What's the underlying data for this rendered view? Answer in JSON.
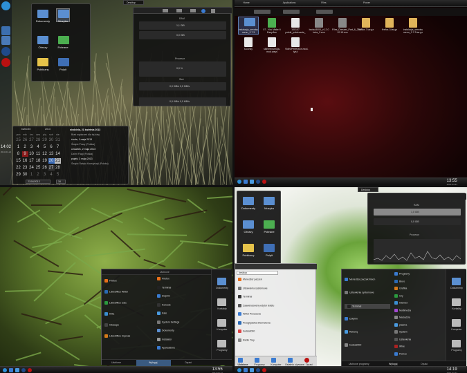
{
  "q1": {
    "desktop_tab": "Desktop",
    "folders": [
      {
        "label": "Dokumenty",
        "color": "#5b8fd1"
      },
      {
        "label": "Muzyka",
        "color": "#5b8fd1"
      },
      {
        "label": "Obrazy",
        "color": "#5b8fd1"
      },
      {
        "label": "Pobrane",
        "color": "#4caf50"
      },
      {
        "label": "Publiczny",
        "color": "#e6c34a"
      },
      {
        "label": "Pulpit",
        "color": "#3f6fb5"
      }
    ],
    "monitor_sections": [
      "RAM",
      "Procesor",
      "Sieć"
    ],
    "monitor_values": [
      "1,1 GiB",
      "0,0 GiB",
      "0,0 %",
      "0,0 KiB/s  0,0 KiB/s",
      "0,0 KiB/s  0,0 KiB/s"
    ],
    "clock": {
      "time": "14:02",
      "date": "2013-04-21"
    },
    "calendar": {
      "month": "kwiecień",
      "year": "2013",
      "headers": [
        "pon",
        "wto",
        "śro",
        "czw",
        "pią",
        "sob",
        "nie"
      ],
      "weeks": [
        [
          "25",
          "26",
          "27",
          "28",
          "29",
          "30",
          "31"
        ],
        [
          "1",
          "2",
          "3",
          "4",
          "5",
          "6",
          "7"
        ],
        [
          "8",
          "9",
          "10",
          "11",
          "12",
          "13",
          "14"
        ],
        [
          "15",
          "16",
          "17",
          "18",
          "19",
          "20",
          "21"
        ],
        [
          "22",
          "23",
          "24",
          "25",
          "26",
          "27",
          "28"
        ],
        [
          "29",
          "30",
          "1",
          "2",
          "3",
          "4",
          "5"
        ]
      ],
      "date_field": "21/04/2013",
      "week_field": "16",
      "events_title": "niedziela, 21 kwietnia 2013",
      "events": [
        "Brak wydarzeń dla tej daty",
        "środa, 1 maja 2013",
        "Święto Pracy (Polska)",
        "czwartek, 2 maja 2013",
        "Dzień Flagi (Polska)",
        "piątek, 3 maja 2013",
        "Święto Święto Konstytucji (Polska)"
      ]
    }
  },
  "q2": {
    "tabs": [
      "Home",
      "Applications",
      "Files",
      "Power"
    ],
    "files": [
      {
        "label": "instalacja_serwisu menu_2.7.3",
        "kind": "folder"
      },
      {
        "label": "07 - You Make It Easy.flac",
        "kind": "audio"
      },
      {
        "label": "100107 polski_pobierania_",
        "kind": "doc"
      },
      {
        "label": "budsa3000_v1.2.0 beta_2.exe",
        "kind": "gear"
      },
      {
        "label": "Files_Dresser_Part_6_2013-12-15.exe",
        "kind": "gear"
      },
      {
        "label": "firefox-7.tar.gz",
        "kind": "archive"
      },
      {
        "label": "firefox-3.tar.gz",
        "kind": "archive"
      },
      {
        "label": "instalacja_serwisu menu_2.7.3.tar.gz",
        "kind": "archive"
      },
      {
        "label": "$.conky",
        "kind": "doc"
      },
      {
        "label": "skinmenumoja-mod.ways",
        "kind": "doc"
      },
      {
        "label": "VideoPerfection.mod-tytul",
        "kind": "doc"
      }
    ],
    "clock": {
      "time": "13:55",
      "date": "2013-04-21"
    }
  },
  "q3": {
    "menu_header": "Ulubione",
    "menu_items": [
      {
        "label": "Firefox",
        "color": "#e86f1a"
      },
      {
        "label": "LibreOffice Writer",
        "color": "#2a6ab5"
      },
      {
        "label": "LibreOffice Calc",
        "color": "#2b9a3e"
      },
      {
        "label": "Krita",
        "color": "#3a8ed1"
      },
      {
        "label": "Inkscape",
        "color": "#444"
      },
      {
        "label": "LibreOffice Impress",
        "color": "#d47a1a"
      }
    ],
    "menu_items_right": [
      {
        "label": "Firefox",
        "color": "#e86f1a"
      },
      {
        "label": "Terminal",
        "color": "#222"
      },
      {
        "label": "Dolphin",
        "color": "#3a7bd1"
      },
      {
        "label": "Konsole",
        "color": "#333"
      },
      {
        "label": "Kate",
        "color": "#4a9be0"
      },
      {
        "label": "System Settings",
        "color": "#777"
      },
      {
        "label": "Dokumenty",
        "color": "#5b8fd1"
      },
      {
        "label": "Instalator",
        "color": "#999"
      },
      {
        "label": "Applications",
        "color": "#3a7bd1"
      }
    ],
    "side_items": [
      "Dokumenty",
      "Kontakty",
      "Komputer",
      "Programy"
    ],
    "bottom_tabs": [
      "Ulubione",
      "Wyloguj",
      "Opuść"
    ],
    "clock": {
      "time": "13:55",
      "date": "2013-04-21"
    }
  },
  "q4": {
    "desktop_tab": "Desktop",
    "folders": [
      {
        "label": "Dokumenty",
        "color": "#5b8fd1"
      },
      {
        "label": "Muzyka",
        "color": "#5b8fd1"
      },
      {
        "label": "Obrazy",
        "color": "#5b8fd1"
      },
      {
        "label": "Pobrane",
        "color": "#4caf50"
      },
      {
        "label": "Publiczny",
        "color": "#e6c34a"
      },
      {
        "label": "Pulpit",
        "color": "#3f6fb5"
      }
    ],
    "monitor_sections": [
      "RAM",
      "Procesor"
    ],
    "monitor_values": [
      "1,0 GiB",
      "0,0 GiB"
    ],
    "launcher_search": "desktop",
    "launcher_items": [
      "Menedżer paczek",
      "Ustawienia systemowe",
      "Terminal",
      "Zaawansowany edytor tekstu",
      "Wirtul Procesora",
      "Przeglądarka internetowa",
      "budsa3000",
      "Radio Tray"
    ],
    "launcher_tabs": [
      "Ulubione",
      "Programy",
      "Komputer",
      "Ostatnio używane",
      "Opuść"
    ],
    "app_menu_left": [
      "Menedżer paczek Muon",
      "Ustawienia systemowe",
      "Terminal",
      "Dolphin",
      "Rekonq",
      "budsa3000"
    ],
    "app_menu_right": [
      "Programy",
      "Biuro",
      "Grafika",
      "Gry",
      "Internet",
      "Multimedia",
      "Narzędzia",
      "plasma",
      "System",
      "Ustawienia",
      "Wine",
      "Pomoc"
    ],
    "side_items": [
      "Dokumenty",
      "Kontakty",
      "Komputer",
      "Programy"
    ],
    "bottom_tabs": [
      "Ulubione programy",
      "Wyloguj",
      "Opuść"
    ],
    "clock": {
      "time": "14:19",
      "date": "2013-04-21"
    }
  }
}
